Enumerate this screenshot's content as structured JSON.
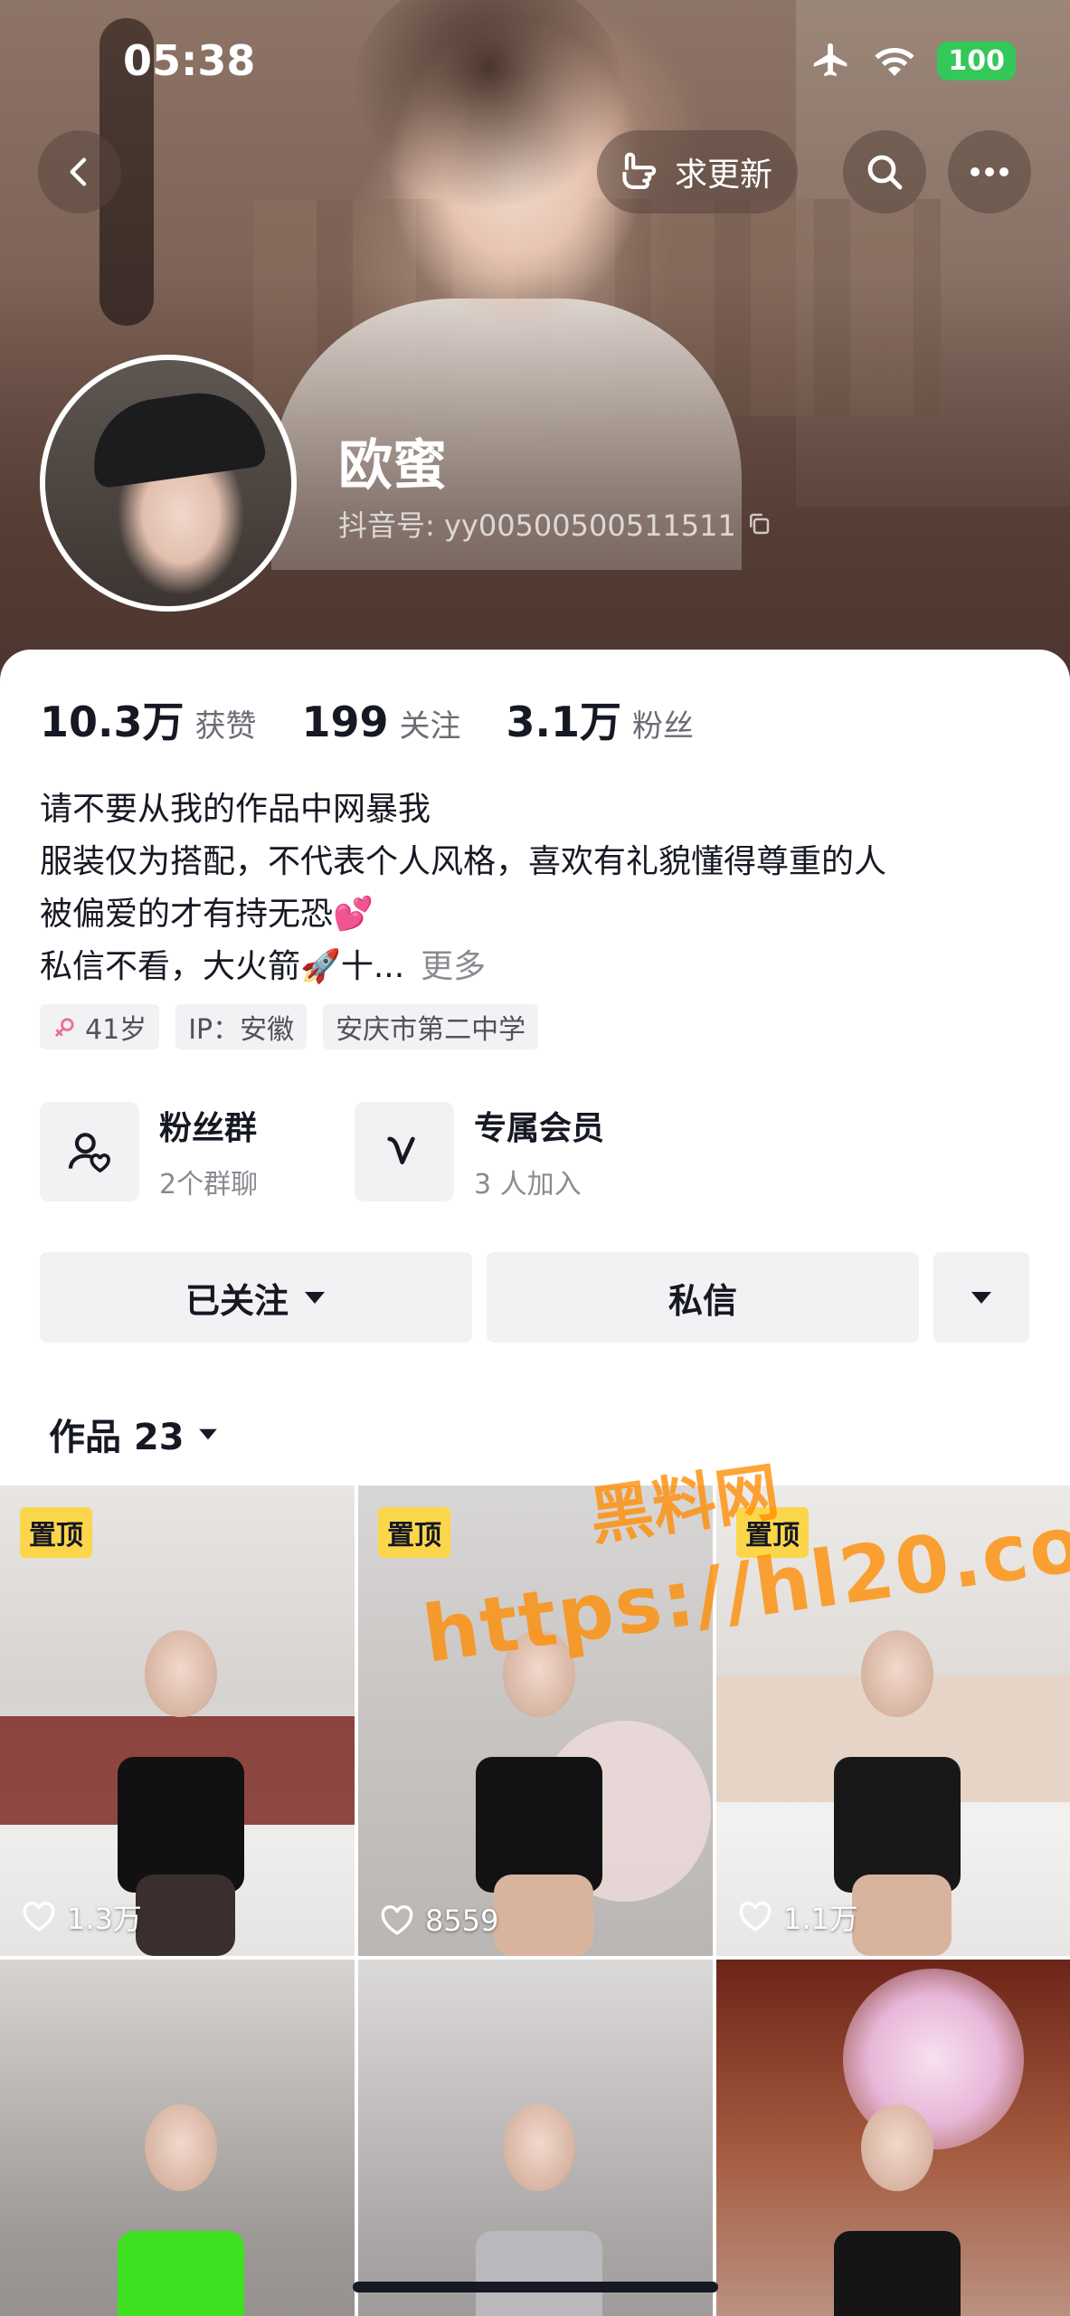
{
  "status_bar": {
    "time": "05:38",
    "battery": "100"
  },
  "nav": {
    "update_label": "求更新"
  },
  "profile": {
    "nickname": "欧蜜",
    "douyin_id": "抖音号: yy00500500511511"
  },
  "stats": [
    {
      "value": "10.3万",
      "label": "获赞"
    },
    {
      "value": "199",
      "label": "关注"
    },
    {
      "value": "3.1万",
      "label": "粉丝"
    }
  ],
  "bio": {
    "lines": [
      "请不要从我的作品中网暴我",
      "服装仅为搭配，不代表个人风格，喜欢有礼貌懂得尊重的人",
      "被偏爱的才有持无恐💕",
      "私信不看，大火箭🚀十..."
    ],
    "more": "更多"
  },
  "tags": {
    "age": "41岁",
    "ip": "IP：安徽",
    "school": "安庆市第二中学"
  },
  "features": {
    "fan_group": {
      "title": "粉丝群",
      "subtitle": "2个群聊"
    },
    "membership": {
      "title": "专属会员",
      "subtitle": "3 人加入"
    }
  },
  "actions": {
    "followed": "已关注",
    "message": "私信"
  },
  "works": {
    "label": "作品 23"
  },
  "videos": [
    {
      "pinned": "置顶",
      "likes": "1.3万"
    },
    {
      "pinned": "置顶",
      "likes": "8559"
    },
    {
      "pinned": "置顶",
      "likes": "1.1万"
    },
    {
      "pinned": "",
      "likes": ""
    },
    {
      "pinned": "",
      "likes": ""
    },
    {
      "pinned": "",
      "likes": ""
    }
  ],
  "watermark": {
    "line1": "黑料网",
    "line2": "https://hl20.co"
  },
  "colors": {
    "accent_pin": "#fcd64a",
    "battery": "#34c759",
    "watermark": "#ff8c00"
  }
}
